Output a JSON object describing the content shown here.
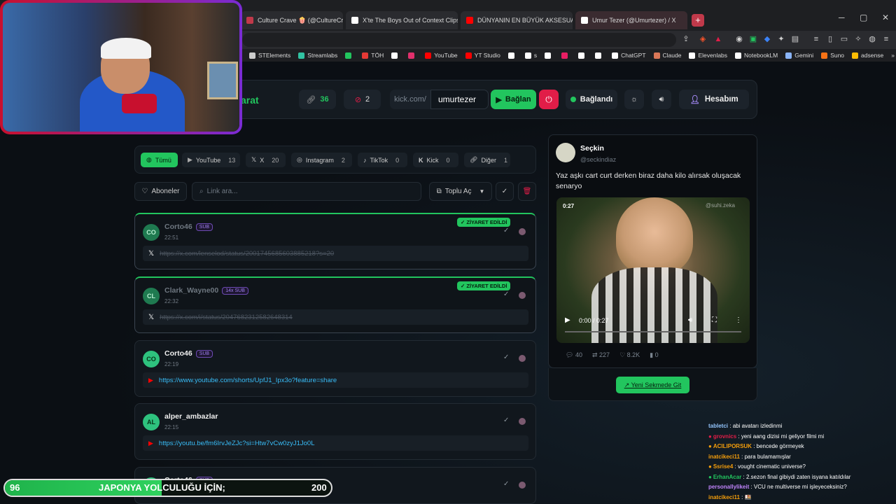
{
  "browser": {
    "tabs": [
      {
        "title": "Culture Crave 🍿 (@CultureCrave) / X",
        "color": "#c0394a"
      },
      {
        "title": "X'te The Boys Out of Context Clips: \"I",
        "color": "#ffffff"
      },
      {
        "title": "DÜNYANIN EN BÜYÜK AKSESUAR FU",
        "color": "#ff0000"
      },
      {
        "title": "Umur Tezer (@Umurtezer) / X",
        "color": "#ffffff"
      }
    ],
    "new_tab": "+",
    "bookmarks": [
      {
        "label": "STElements",
        "color": "#cccccc"
      },
      {
        "label": "Streamlabs",
        "color": "#31c3a2"
      },
      {
        "label": "",
        "color": "#22c55e"
      },
      {
        "label": "TÖH",
        "color": "#e53935"
      },
      {
        "label": "",
        "color": "#ffffff"
      },
      {
        "label": "",
        "color": "#e1306c"
      },
      {
        "label": "YouTube",
        "color": "#ff0000"
      },
      {
        "label": "YT Studio",
        "color": "#ff0000"
      },
      {
        "label": "",
        "color": "#ffffff"
      },
      {
        "label": "s",
        "color": "#ffffff"
      },
      {
        "label": "",
        "color": "#ffffff"
      },
      {
        "label": "",
        "color": "#e91e63"
      },
      {
        "label": "",
        "color": "#ffffff"
      },
      {
        "label": "",
        "color": "#ffffff"
      },
      {
        "label": "ChatGPT",
        "color": "#ffffff"
      },
      {
        "label": "Claude",
        "color": "#d97757"
      },
      {
        "label": "Elevenlabs",
        "color": "#ffffff"
      },
      {
        "label": "NotebookLM",
        "color": "#ffffff"
      },
      {
        "label": "Gemini",
        "color": "#8ab4f8"
      },
      {
        "label": "Suno",
        "color": "#f97316"
      },
      {
        "label": "adsense",
        "color": "#fbbc04"
      }
    ],
    "more": "»"
  },
  "app": {
    "brand_fragment": "arat",
    "links_count": "36",
    "blocked_count": "2",
    "kick_prefix": "kick.com/",
    "kick_username": "umurtezer",
    "connect_label": "Bağlan",
    "status_label": "Bağlandı",
    "account_label": "Hesabım"
  },
  "filters": {
    "tabs": [
      {
        "label": "Tümü",
        "count": "",
        "active": true
      },
      {
        "label": "YouTube",
        "count": "13"
      },
      {
        "label": "X",
        "count": "20"
      },
      {
        "label": "Instagram",
        "count": "2"
      },
      {
        "label": "TikTok",
        "count": "0"
      },
      {
        "label": "Kick",
        "count": "0"
      },
      {
        "label": "Diğer",
        "count": "1"
      }
    ],
    "subscribers_label": "Aboneler",
    "search_placeholder": "Link ara...",
    "bulk_open_label": "Toplu Aç"
  },
  "links": [
    {
      "initials": "CO",
      "user": "Corto46",
      "badge": "SUB",
      "time": "22:51",
      "url": "https://x.com/lenselod/status/2001745685603885218?s=20",
      "visited": true,
      "visited_label": "✓ ZİYARET EDİLDİ",
      "platform": "x"
    },
    {
      "initials": "CL",
      "user": "Clark_Wayne00",
      "badge": "14x SUB",
      "time": "22:32",
      "url": "https://x.com/i/status/2047682312582648314",
      "visited": true,
      "visited_label": "✓ ZİYARET EDİLDİ",
      "platform": "x"
    },
    {
      "initials": "CO",
      "user": "Corto46",
      "badge": "SUB",
      "time": "22:19",
      "url": "https://www.youtube.com/shorts/UpfJ1_Ipx3o?feature=share",
      "visited": false,
      "platform": "youtube"
    },
    {
      "initials": "AL",
      "user": "alper_ambazlar",
      "badge": "",
      "time": "22:15",
      "url": "https://youtu.be/fm6IrvJeZJc?si=Htw7vCw0zyJ1Jo0L",
      "visited": false,
      "platform": "youtube"
    },
    {
      "initials": "CO",
      "user": "Corto46",
      "badge": "SUB",
      "time": "",
      "url": "",
      "visited": false,
      "platform": "youtube"
    }
  ],
  "tweet": {
    "author": "Seçkin",
    "handle": "@seckindiaz",
    "text": "Yaz aşkı cart curt derken biraz daha kilo alırsak oluşacak senaryo",
    "video_duration_badge": "0:27",
    "watermark": "@suhi.zeka",
    "video_time": "0:00 / 0:27",
    "video_progress": 0.0,
    "replies": "40",
    "retweets": "227",
    "likes": "8.2K",
    "views": "0",
    "open_tab_label": "↗ Yeni Sekmede Git"
  },
  "chat": [
    {
      "user": "tabletci",
      "msg": "abi avatarı izledinmi",
      "color": "#93c5fd",
      "icon": false
    },
    {
      "user": "grovnics",
      "msg": "yeni aang dizisi mi geliyor filmi mi",
      "color": "#e11d48",
      "icon": true
    },
    {
      "user": "ACILIPORSUK",
      "msg": "bencede görmeyek",
      "color": "#f59e0b",
      "icon": true
    },
    {
      "user": "inatcikeci11",
      "msg": "para bulamamışlar",
      "color": "#f59e0b",
      "icon": false
    },
    {
      "user": "Ssrise4",
      "msg": "vought cinematic universe?",
      "color": "#f59e0b",
      "icon": true
    },
    {
      "user": "ErhanAcar",
      "msg": "2.sezon final gibiydi zaten isyana katıldılar",
      "color": "#22c55e",
      "icon": true
    },
    {
      "user": "personallylikeit",
      "msg": "VCU ne multiverse mi işleyeceksiniz?",
      "color": "#c084fc",
      "icon": false
    },
    {
      "user": "inatcikeci11",
      "msg": "🍱",
      "color": "#f59e0b",
      "icon": false
    }
  ],
  "goal": {
    "current": "96",
    "label": "JAPONYA YOLCULUĞU İÇİN;",
    "target": "200",
    "progress": 0.48
  }
}
